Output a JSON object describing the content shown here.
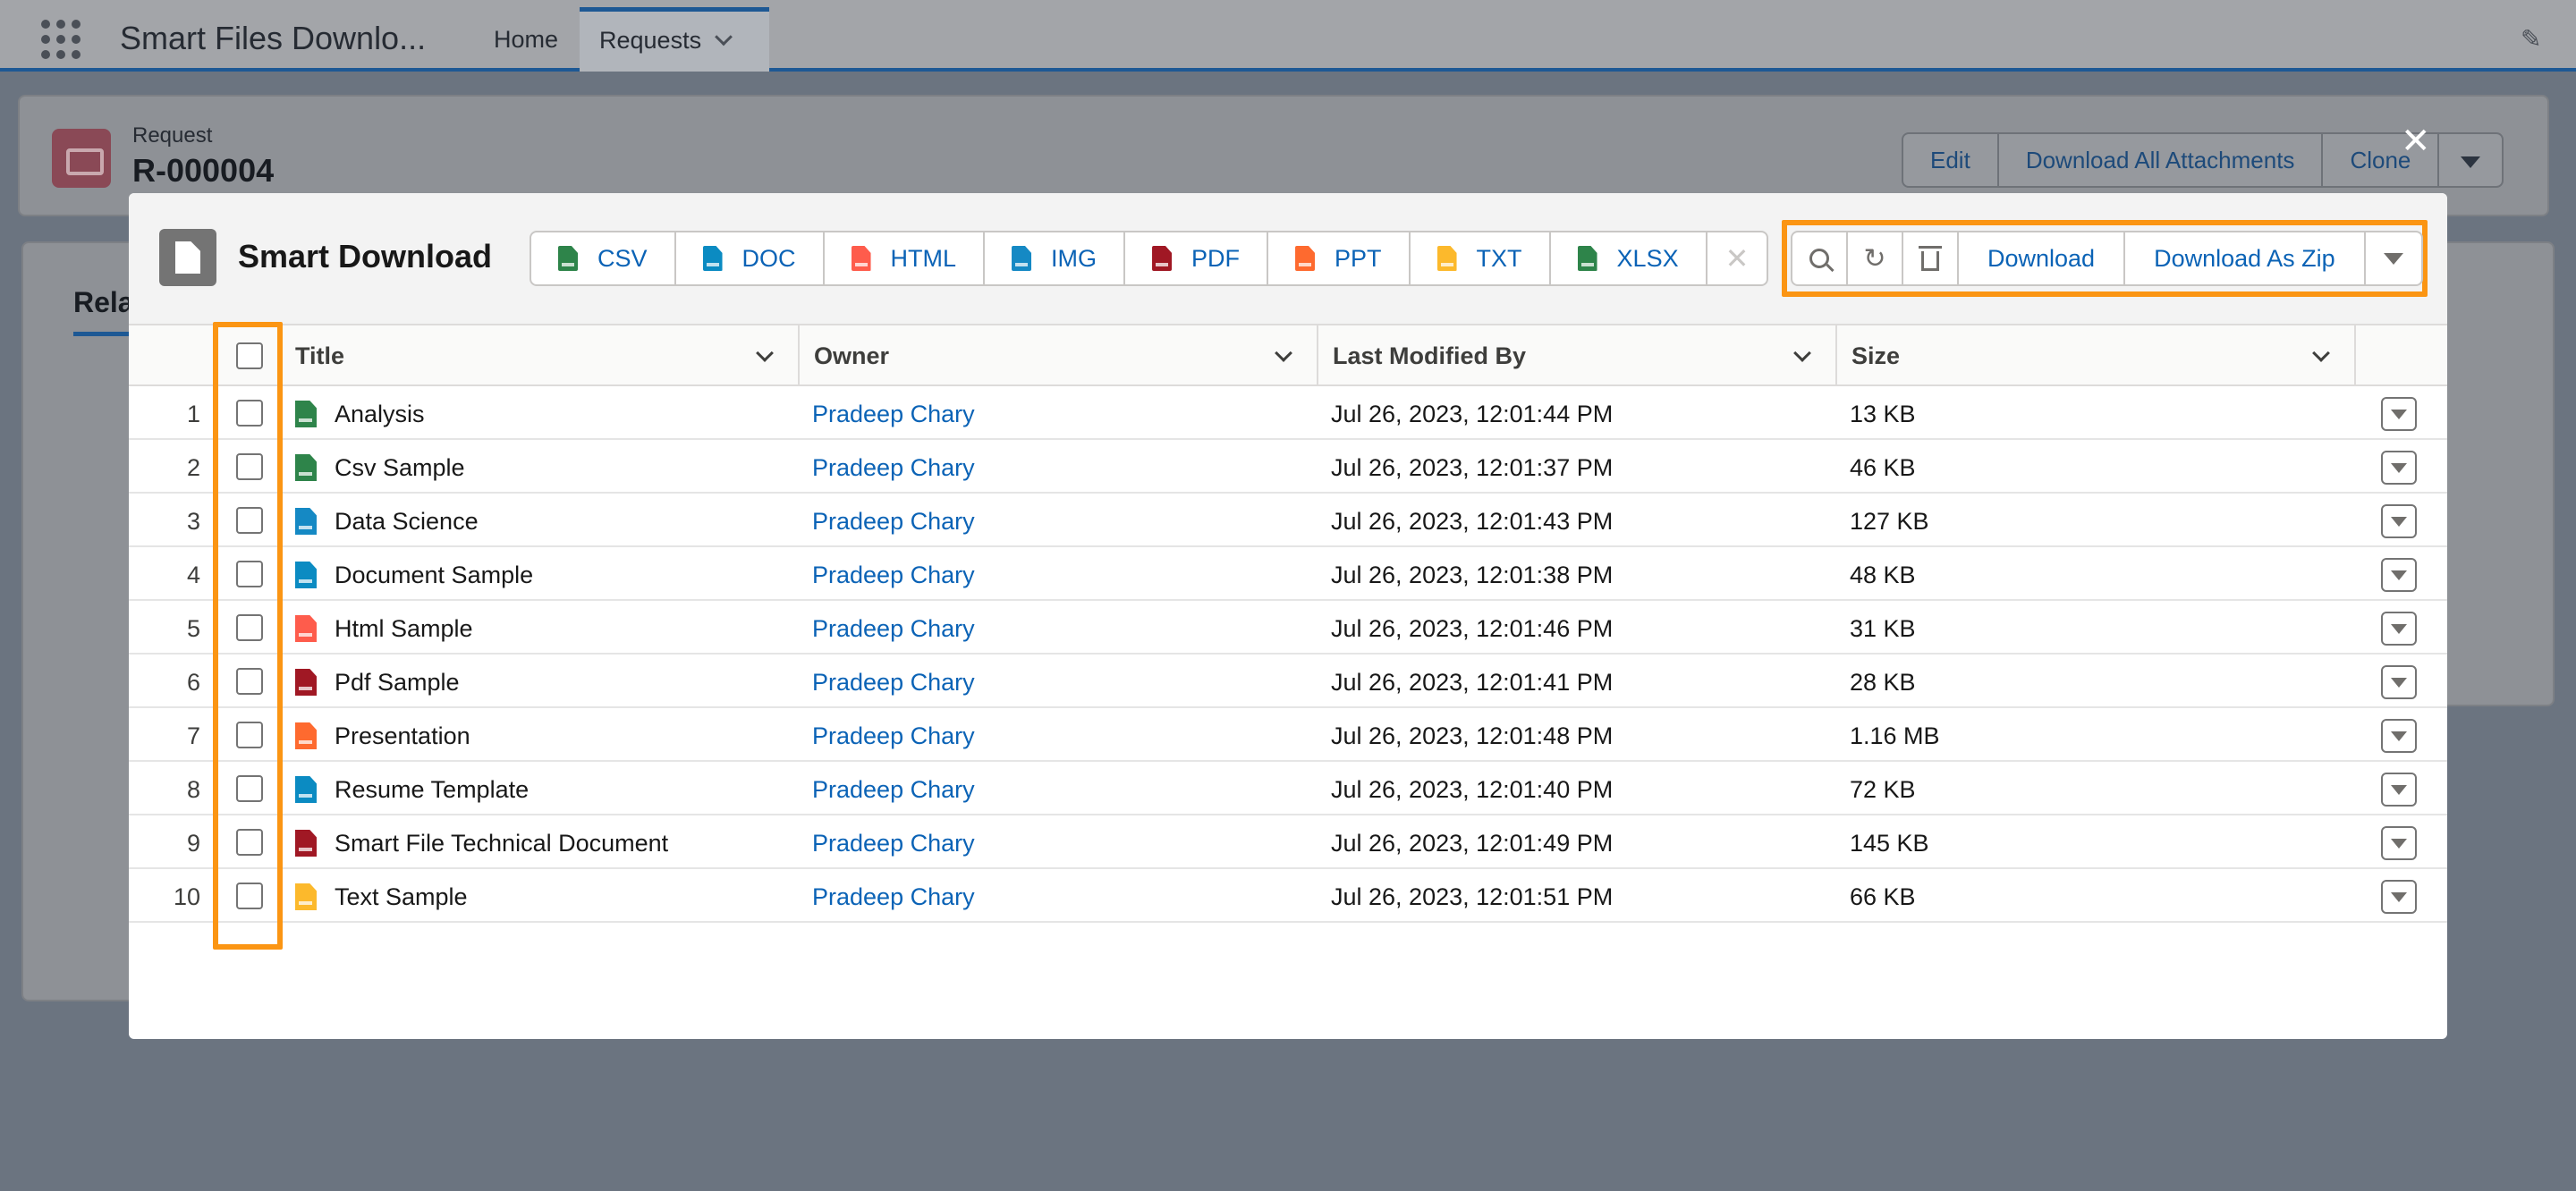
{
  "app": {
    "name": "Smart Files Downlo...",
    "nav": [
      {
        "label": "Home"
      },
      {
        "label": "Requests"
      }
    ]
  },
  "record": {
    "type": "Request",
    "name": "R-000004",
    "buttons": [
      "Edit",
      "Download All Attachments",
      "Clone"
    ]
  },
  "related": {
    "tab_label": "Rela"
  },
  "modal": {
    "title": "Smart Download",
    "filters": [
      {
        "label": "CSV",
        "color": "#2e844a"
      },
      {
        "label": "DOC",
        "color": "#0b8bc2"
      },
      {
        "label": "HTML",
        "color": "#fe5c4c"
      },
      {
        "label": "IMG",
        "color": "#1589c4"
      },
      {
        "label": "PDF",
        "color": "#a01824"
      },
      {
        "label": "PPT",
        "color": "#fe6a2f"
      },
      {
        "label": "TXT",
        "color": "#fcb92c"
      },
      {
        "label": "XLSX",
        "color": "#2e844a"
      }
    ],
    "clear_icon": "close-icon",
    "actions": {
      "search_icon": "search-icon",
      "refresh_icon": "refresh-icon",
      "delete_icon": "trash-icon",
      "download": "Download",
      "download_zip": "Download As Zip"
    }
  },
  "table": {
    "columns": [
      "Title",
      "Owner",
      "Last Modified By",
      "Size"
    ],
    "rows": [
      {
        "num": "1",
        "title": "Analysis",
        "type": "xlsx",
        "owner": "Pradeep Chary",
        "modified": "Jul 26, 2023, 12:01:44 PM",
        "size": "13 KB"
      },
      {
        "num": "2",
        "title": "Csv Sample",
        "type": "csv",
        "owner": "Pradeep Chary",
        "modified": "Jul 26, 2023, 12:01:37 PM",
        "size": "46 KB"
      },
      {
        "num": "3",
        "title": "Data Science",
        "type": "img",
        "owner": "Pradeep Chary",
        "modified": "Jul 26, 2023, 12:01:43 PM",
        "size": "127 KB"
      },
      {
        "num": "4",
        "title": "Document Sample",
        "type": "doc",
        "owner": "Pradeep Chary",
        "modified": "Jul 26, 2023, 12:01:38 PM",
        "size": "48 KB"
      },
      {
        "num": "5",
        "title": "Html Sample",
        "type": "html",
        "owner": "Pradeep Chary",
        "modified": "Jul 26, 2023, 12:01:46 PM",
        "size": "31 KB"
      },
      {
        "num": "6",
        "title": "Pdf Sample",
        "type": "pdf",
        "owner": "Pradeep Chary",
        "modified": "Jul 26, 2023, 12:01:41 PM",
        "size": "28 KB"
      },
      {
        "num": "7",
        "title": "Presentation",
        "type": "ppt",
        "owner": "Pradeep Chary",
        "modified": "Jul 26, 2023, 12:01:48 PM",
        "size": "1.16 MB"
      },
      {
        "num": "8",
        "title": "Resume Template",
        "type": "doc",
        "owner": "Pradeep Chary",
        "modified": "Jul 26, 2023, 12:01:40 PM",
        "size": "72 KB"
      },
      {
        "num": "9",
        "title": "Smart File Technical Document",
        "type": "pdf",
        "owner": "Pradeep Chary",
        "modified": "Jul 26, 2023, 12:01:49 PM",
        "size": "145 KB"
      },
      {
        "num": "10",
        "title": "Text Sample",
        "type": "txt",
        "owner": "Pradeep Chary",
        "modified": "Jul 26, 2023, 12:01:51 PM",
        "size": "66 KB"
      }
    ]
  },
  "colors": {
    "accent": "#0b63b6",
    "highlight": "#fb9513",
    "xlsx": "#2e844a",
    "csv": "#2e844a",
    "img": "#1589c4",
    "doc": "#0b8bc2",
    "html": "#fe5c4c",
    "pdf": "#a01824",
    "ppt": "#fe6a2f",
    "txt": "#fcb92c"
  }
}
